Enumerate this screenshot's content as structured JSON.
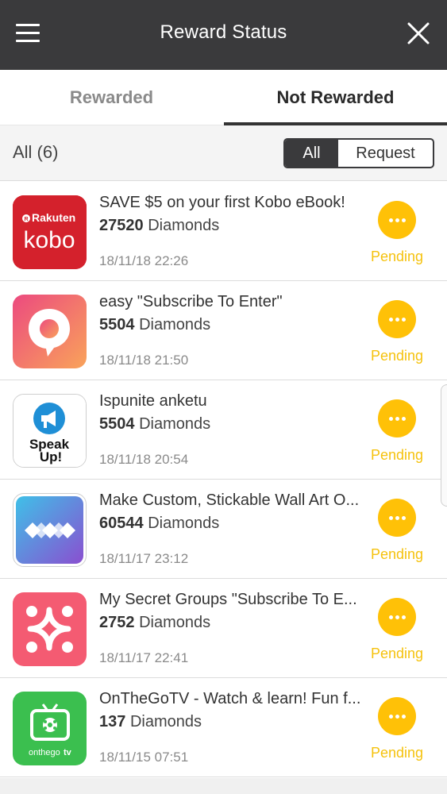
{
  "header": {
    "title": "Reward Status",
    "menu_icon": "hamburger-menu-icon",
    "close_icon": "close-icon"
  },
  "tabs": [
    {
      "label": "Rewarded",
      "active": false
    },
    {
      "label": "Not Rewarded",
      "active": true
    }
  ],
  "filter": {
    "count_label": "All (6)",
    "options": [
      {
        "label": "All",
        "selected": true
      },
      {
        "label": "Request",
        "selected": false
      }
    ]
  },
  "colors": {
    "header_bg": "#3a3a3c",
    "pending_accent": "#ffc107",
    "pending_text": "#f5c20e"
  },
  "items": [
    {
      "name": "SAVE $5 on your first Kobo eBook!",
      "diamonds": "27520",
      "unit": "Diamonds",
      "date": "18/11/18 22:26",
      "status": "Pending",
      "icon": "kobo-app-icon",
      "icon_text_top": "Rakuten",
      "icon_text_main": "kobo"
    },
    {
      "name": "easy \"Subscribe To Enter\"",
      "diamonds": "5504",
      "unit": "Diamonds",
      "date": "18/11/18 21:50",
      "status": "Pending",
      "icon": "speech-bubble-app-icon"
    },
    {
      "name": "Ispunite anketu",
      "diamonds": "5504",
      "unit": "Diamonds",
      "date": "18/11/18 20:54",
      "status": "Pending",
      "icon": "speak-up-app-icon",
      "icon_text_a": "Speak",
      "icon_text_b": "Up!"
    },
    {
      "name": "Make Custom, Stickable Wall Art O...",
      "diamonds": "60544",
      "unit": "Diamonds",
      "date": "18/11/17 23:12",
      "status": "Pending",
      "icon": "diamond-tiles-app-icon"
    },
    {
      "name": "My Secret Groups \"Subscribe To E...",
      "diamonds": "2752",
      "unit": "Diamonds",
      "date": "18/11/17 22:41",
      "status": "Pending",
      "icon": "groups-app-icon"
    },
    {
      "name": "OnTheGoTV - Watch & learn! Fun f...",
      "diamonds": "137",
      "unit": "Diamonds",
      "date": "18/11/15 07:51",
      "status": "Pending",
      "icon": "onthegotv-app-icon",
      "icon_text_a": "onthego",
      "icon_text_b": "tv"
    }
  ]
}
